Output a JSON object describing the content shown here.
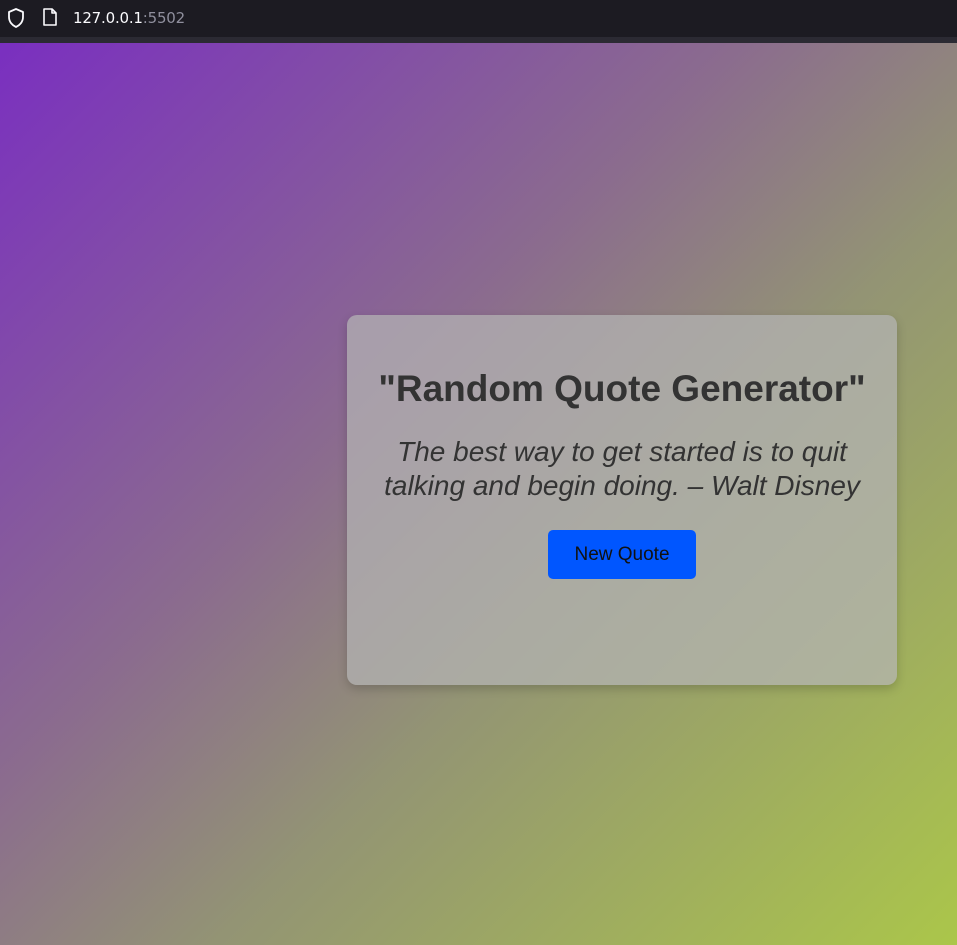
{
  "browser": {
    "url_host": "127.0.0.1",
    "url_port": ":5502",
    "icons": [
      "shield-icon",
      "page-icon"
    ]
  },
  "page": {
    "title": "\"Random Quote Generator\"",
    "quote": "The best way to get started is to quit talking and begin doing. – Walt Disney",
    "button_label": "New Quote",
    "colors": {
      "gradient_start": "#7a2fc0",
      "gradient_end": "#abc64a",
      "button_bg": "#0056ff",
      "text": "#333333"
    }
  }
}
